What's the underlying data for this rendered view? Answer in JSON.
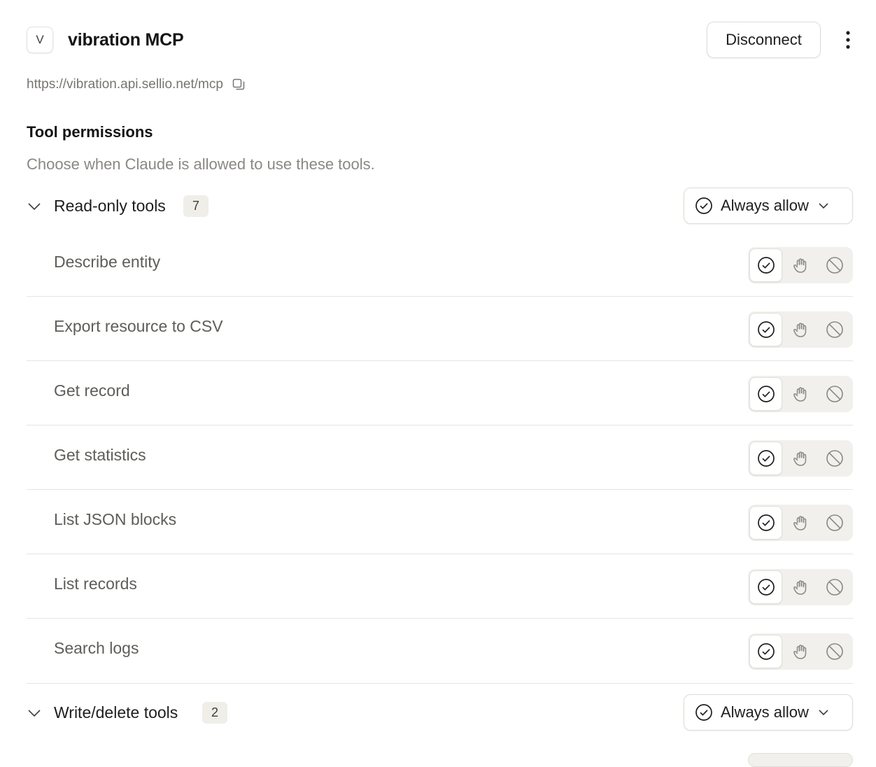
{
  "server": {
    "avatar_letter": "V",
    "name": "vibration MCP",
    "url": "https://vibration.api.sellio.net/mcp"
  },
  "header": {
    "disconnect_label": "Disconnect",
    "more_icon": "more-vertical-icon"
  },
  "permissions": {
    "title": "Tool permissions",
    "subtitle": "Choose when Claude is allowed to use these tools."
  },
  "groups": [
    {
      "label": "Read-only tools",
      "count": "7",
      "policy": "Always allow",
      "expanded": true,
      "tools": [
        {
          "name": "Describe entity",
          "selected": "allow"
        },
        {
          "name": "Export resource to CSV",
          "selected": "allow"
        },
        {
          "name": "Get record",
          "selected": "allow"
        },
        {
          "name": "Get statistics",
          "selected": "allow"
        },
        {
          "name": "List JSON blocks",
          "selected": "allow"
        },
        {
          "name": "List records",
          "selected": "allow"
        },
        {
          "name": "Search logs",
          "selected": "allow"
        }
      ]
    },
    {
      "label": "Write/delete tools",
      "count": "2",
      "policy": "Always allow",
      "expanded": true
    }
  ],
  "colors": {
    "text_primary": "#1f1e1d",
    "text_secondary": "#5e5d59",
    "text_muted": "#8a8882",
    "segment_bg": "#f1f0ec",
    "divider": "#e6e4df"
  },
  "icons": {
    "allow": "check-circle-icon",
    "ask": "hand-icon",
    "block": "block-icon",
    "copy": "copy-icon",
    "chevron": "chevron-down-icon"
  }
}
